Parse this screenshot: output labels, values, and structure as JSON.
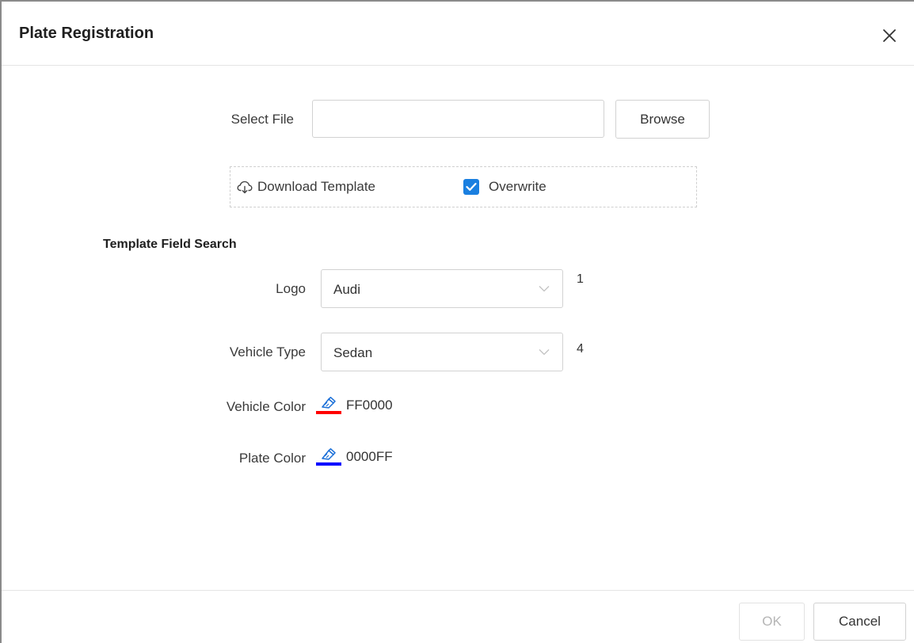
{
  "dialog": {
    "title": "Plate Registration"
  },
  "file": {
    "label": "Select File",
    "value": "",
    "placeholder": "",
    "browse_label": "Browse"
  },
  "options": {
    "download_label": "Download Template",
    "overwrite_label": "Overwrite",
    "overwrite_checked": true
  },
  "template_search": {
    "title": "Template Field Search",
    "logo": {
      "label": "Logo",
      "value": "Audi",
      "count": "1"
    },
    "vehicle_type": {
      "label": "Vehicle Type",
      "value": "Sedan",
      "count": "4"
    },
    "vehicle_color": {
      "label": "Vehicle Color",
      "value": "FF0000",
      "color": "#ff0000"
    },
    "plate_color": {
      "label": "Plate Color",
      "value": "0000FF",
      "color": "#0000ff"
    }
  },
  "footer": {
    "ok_label": "OK",
    "cancel_label": "Cancel"
  },
  "colors": {
    "accent": "#1a7fe0",
    "border": "#d2d2d2",
    "disabled_text": "#b5b5b5"
  },
  "icons": [
    "close-icon",
    "cloud-download-icon",
    "checkmark-icon",
    "chevron-down-icon",
    "color-picker-icon"
  ]
}
